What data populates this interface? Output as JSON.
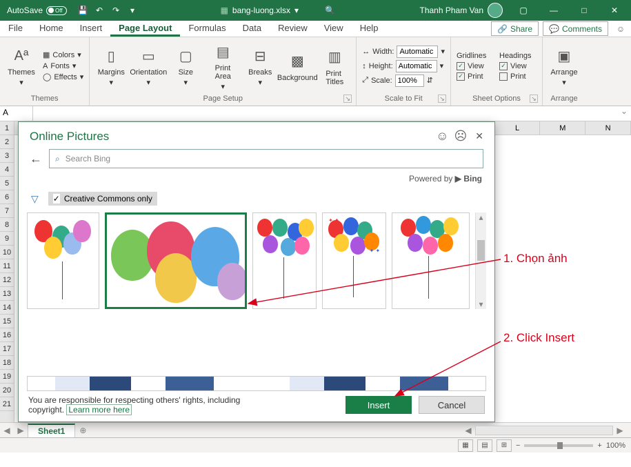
{
  "titlebar": {
    "autosave": "AutoSave",
    "toggle_state": "Off",
    "filename": "bang-luong.xlsx",
    "saved_state": "",
    "username": "Thanh Pham Van",
    "winbtns": {
      "min": "—",
      "max": "□",
      "close": "✕"
    }
  },
  "menubar": {
    "tabs": [
      "File",
      "Home",
      "Insert",
      "Page Layout",
      "Formulas",
      "Data",
      "Review",
      "View",
      "Help"
    ],
    "active_index": 3,
    "share": "Share",
    "comments": "Comments"
  },
  "ribbon": {
    "themes": {
      "label": "Themes",
      "themes_btn": "Themes",
      "colors": "Colors",
      "fonts": "Fonts",
      "effects": "Effects"
    },
    "page_setup": {
      "label": "Page Setup",
      "margins": "Margins",
      "orientation": "Orientation",
      "size": "Size",
      "print_area": "Print\nArea",
      "breaks": "Breaks",
      "background": "Background",
      "print_titles": "Print\nTitles"
    },
    "scale_to_fit": {
      "label": "Scale to Fit",
      "width": "Width:",
      "width_val": "Automatic",
      "height": "Height:",
      "height_val": "Automatic",
      "scale": "Scale:",
      "scale_val": "100%"
    },
    "sheet_options": {
      "label": "Sheet Options",
      "gridlines": "Gridlines",
      "headings": "Headings",
      "view": "View",
      "print": "Print"
    },
    "arrange": {
      "label": "Arrange",
      "btn": "Arrange"
    }
  },
  "namebox": {
    "ref": "A"
  },
  "columns": [
    "L",
    "M",
    "N"
  ],
  "rows": [
    "1",
    "2",
    "3",
    "4",
    "5",
    "6",
    "7",
    "8",
    "9",
    "10",
    "11",
    "12",
    "13",
    "14",
    "15",
    "16",
    "17",
    "18",
    "19",
    "20",
    "21"
  ],
  "dialog": {
    "title": "Online Pictures",
    "search_placeholder": "Search Bing",
    "powered_by": "Powered by",
    "bing": "Bing",
    "cc_only": "Creative Commons only",
    "disclaimer": "You are responsible for respecting others' rights, including copyright.",
    "learn_more": "Learn more here",
    "insert": "Insert",
    "cancel": "Cancel"
  },
  "annotations": {
    "a1": "1. Chọn ảnh",
    "a2": "2. Click Insert"
  },
  "tabs": {
    "sheet1": "Sheet1"
  },
  "statusbar": {
    "zoom": "100%"
  }
}
